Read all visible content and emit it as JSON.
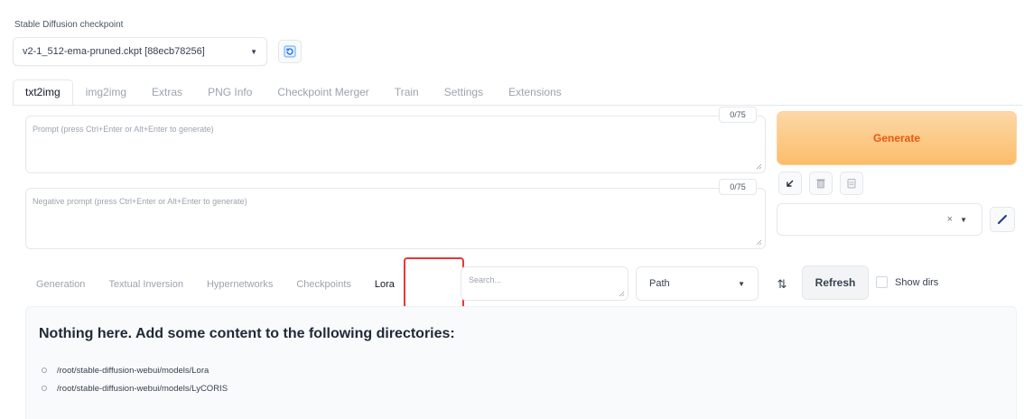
{
  "checkpoint": {
    "label": "Stable Diffusion checkpoint",
    "selected": "v2-1_512-ema-pruned.ckpt [88ecb78256]"
  },
  "main_tabs": [
    {
      "label": "txt2img",
      "active": true
    },
    {
      "label": "img2img",
      "active": false
    },
    {
      "label": "Extras",
      "active": false
    },
    {
      "label": "PNG Info",
      "active": false
    },
    {
      "label": "Checkpoint Merger",
      "active": false
    },
    {
      "label": "Train",
      "active": false
    },
    {
      "label": "Settings",
      "active": false
    },
    {
      "label": "Extensions",
      "active": false
    }
  ],
  "prompt": {
    "placeholder": "Prompt (press Ctrl+Enter or Alt+Enter to generate)",
    "token_count": "0/75"
  },
  "negative_prompt": {
    "placeholder": "Negative prompt (press Ctrl+Enter or Alt+Enter to generate)",
    "token_count": "0/75"
  },
  "generate_label": "Generate",
  "tool_icons": [
    "arrow-down-left-icon",
    "trash-icon",
    "clipboard-icon"
  ],
  "styles_clear_glyph": "×",
  "extra_networks": {
    "tabs": [
      {
        "label": "Generation",
        "active": false
      },
      {
        "label": "Textual Inversion",
        "active": false
      },
      {
        "label": "Hypernetworks",
        "active": false
      },
      {
        "label": "Checkpoints",
        "active": false
      },
      {
        "label": "Lora",
        "active": true
      }
    ],
    "search_placeholder": "Search...",
    "sort_value": "Path",
    "refresh_label": "Refresh",
    "show_dirs_label": "Show dirs",
    "empty_message": "Nothing here. Add some content to the following directories:",
    "directories": [
      "/root/stable-diffusion-webui/models/Lora",
      "/root/stable-diffusion-webui/models/LyCORIS"
    ]
  },
  "colors": {
    "accent": "#ea580c",
    "generate_bg": "#fbbd6b",
    "highlight_box": "#e53935"
  }
}
